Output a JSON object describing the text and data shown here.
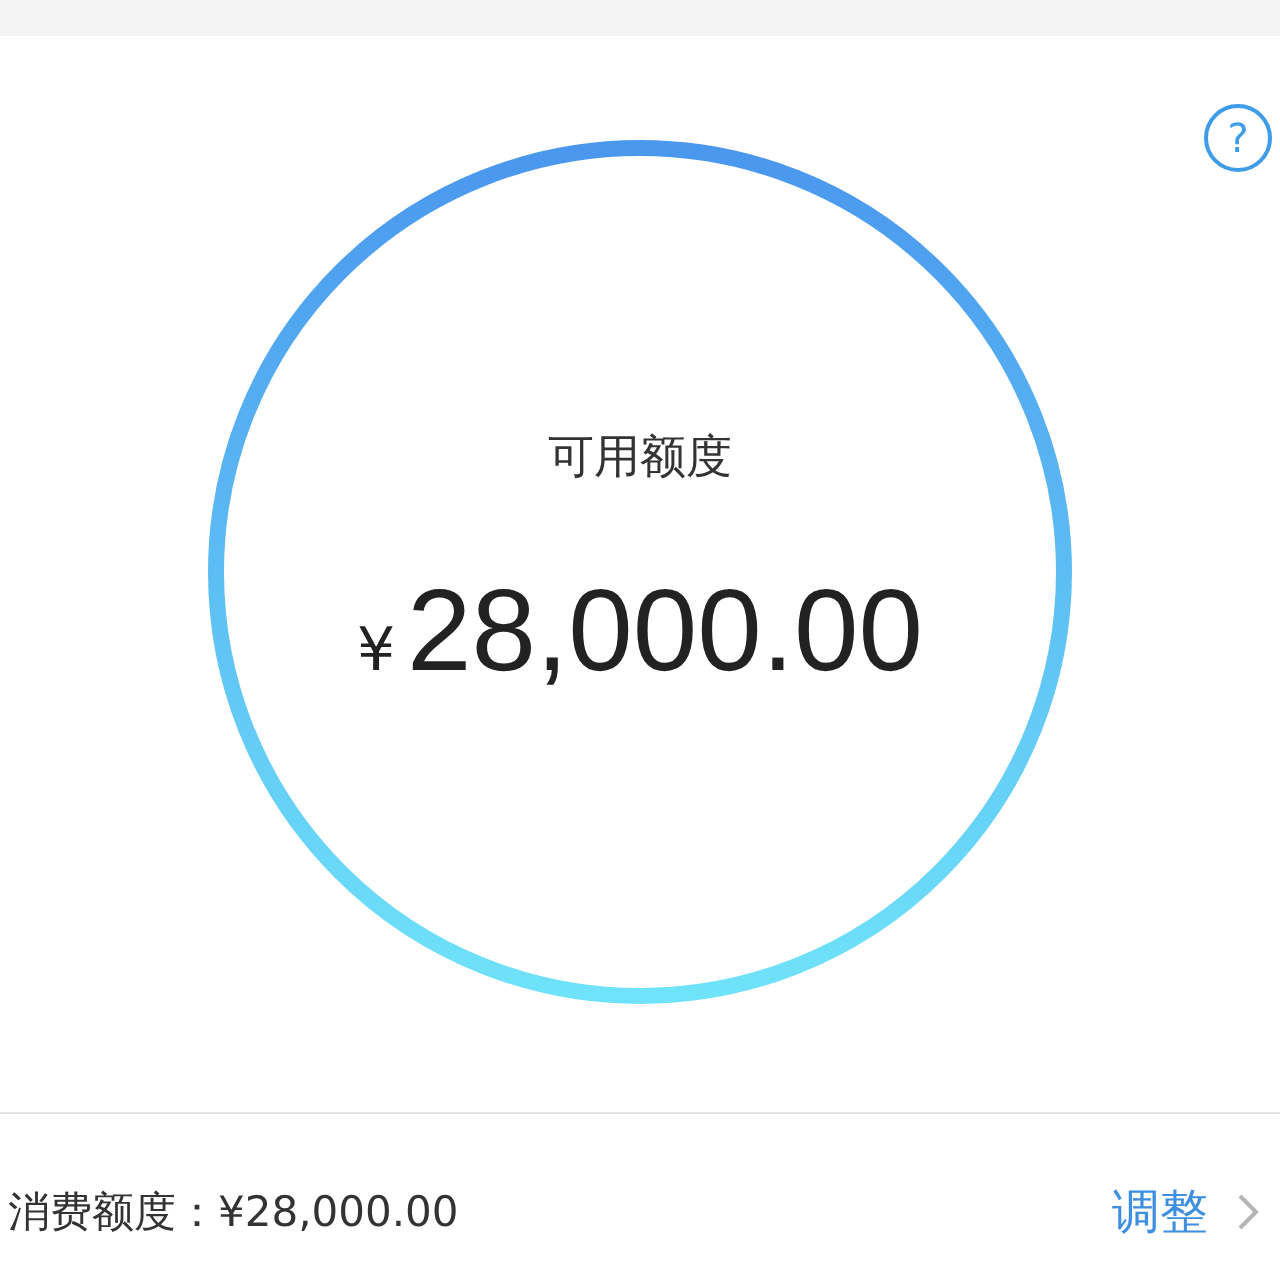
{
  "help": {
    "glyph": "?"
  },
  "credit": {
    "label": "可用额度",
    "currency_symbol": "¥",
    "amount": "28,000.00"
  },
  "spending": {
    "label": "消费额度：¥28,000.00",
    "action": "调整"
  }
}
